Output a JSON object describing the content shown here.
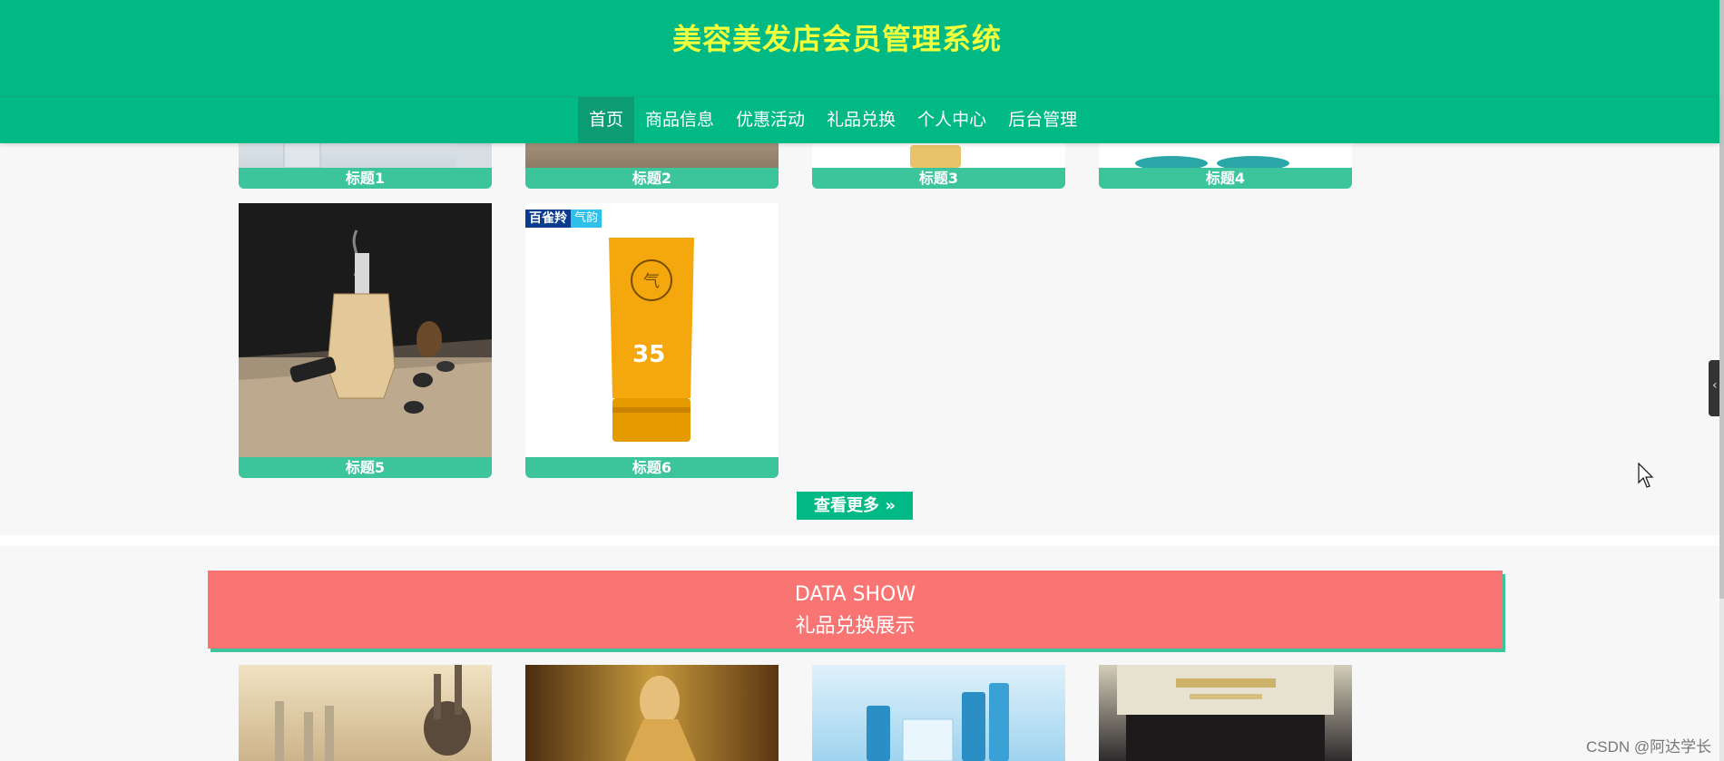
{
  "site": {
    "title": "美容美发店会员管理系统"
  },
  "nav": {
    "items": [
      {
        "label": "首页",
        "active": true
      },
      {
        "label": "商品信息"
      },
      {
        "label": "优惠活动"
      },
      {
        "label": "礼品兑换"
      },
      {
        "label": "个人中心"
      },
      {
        "label": "后台管理"
      }
    ]
  },
  "products": {
    "cards": [
      {
        "title": "标题1"
      },
      {
        "title": "标题2"
      },
      {
        "title": "标题3"
      },
      {
        "title": "标题4"
      },
      {
        "title": "标题5"
      },
      {
        "title": "标题6"
      }
    ],
    "card6_badge": {
      "brand": "百雀羚",
      "sub": "气韵",
      "spf": "35"
    },
    "more_button": "查看更多"
  },
  "gift_section": {
    "banner_en": "DATA SHOW",
    "banner_zh": "礼品兑换展示"
  },
  "watermark": "CSDN @阿达学长",
  "colors": {
    "header": "#00b985",
    "title": "#f1ff3c",
    "caption": "#3cc49b",
    "banner": "#f87574"
  }
}
